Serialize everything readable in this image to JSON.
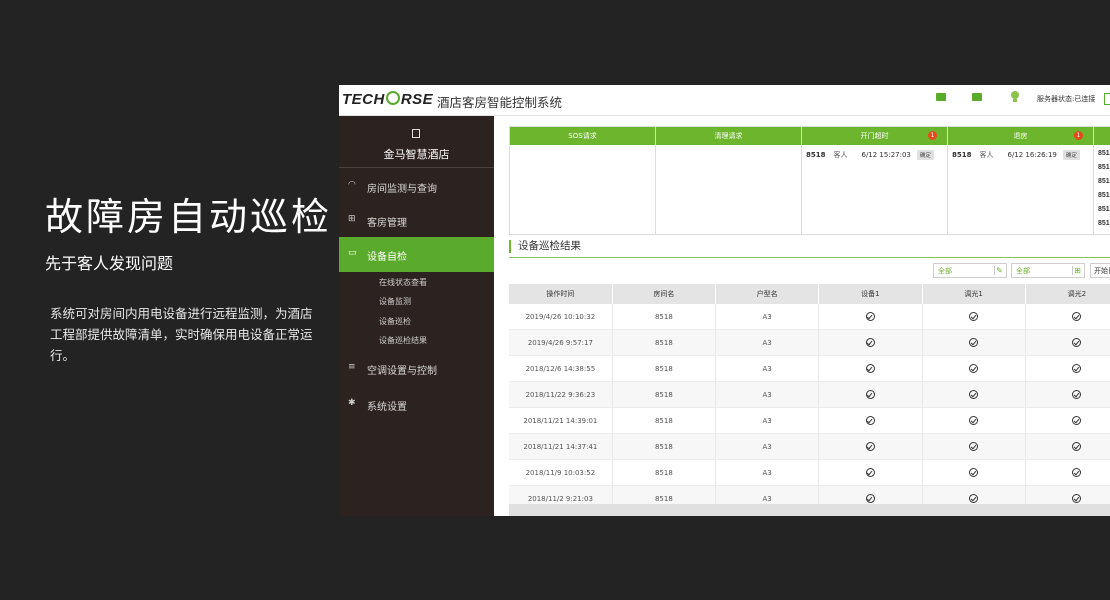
{
  "promo": {
    "headline": "故障房自动巡检",
    "subline": "先于客人发现问题",
    "description": "系统可对房间内用电设备进行远程监测，为酒店工程部提供故障清单，实时确保用电设备正常运行。"
  },
  "app": {
    "logo": {
      "part1": "TECH",
      "part2": "RSE"
    },
    "system_name": "酒店客房智能控制系统",
    "service_status": "服务器状态:已连接",
    "hotel_name": "金马智慧酒店",
    "nav": [
      {
        "label": "房间监测与查询",
        "icon": "gauge-icon"
      },
      {
        "label": "客房管理",
        "icon": "grid-icon"
      },
      {
        "label": "设备自检",
        "icon": "monitor-icon",
        "active": true
      },
      {
        "label": "空调设置与控制",
        "icon": "aircon-icon"
      },
      {
        "label": "系统设置",
        "icon": "gear-icon"
      }
    ],
    "subnav": [
      "在线状态查看",
      "设备监测",
      "设备巡检",
      "设备巡检结果"
    ],
    "requests": [
      {
        "title": "SOS请求",
        "rows": []
      },
      {
        "title": "清理请求",
        "rows": []
      },
      {
        "title": "开门超时",
        "badge": "1",
        "rows": [
          {
            "room": "8518",
            "who": "客人",
            "time": "6/12 15:27:03",
            "action": "确定"
          }
        ]
      },
      {
        "title": "退房",
        "badge": "1",
        "rows": [
          {
            "room": "8518",
            "who": "客人",
            "time": "6/12 16:26:19",
            "action": "确定"
          }
        ]
      },
      {
        "title": "",
        "rows": [
          {
            "room": "851"
          },
          {
            "room": "851"
          },
          {
            "room": "851"
          },
          {
            "room": "851"
          },
          {
            "room": "851"
          },
          {
            "room": "851"
          }
        ]
      }
    ],
    "section_title": "设备巡检结果",
    "filters": {
      "f1": "全部",
      "f2": "全部",
      "start": "开始日"
    },
    "table": {
      "headers": [
        "操作时间",
        "房间名",
        "户型名",
        "设备1",
        "调光1",
        "调光2"
      ],
      "rows": [
        [
          "2019/4/26 10:10:32",
          "8518",
          "A3"
        ],
        [
          "2019/4/26 9:57:17",
          "8518",
          "A3"
        ],
        [
          "2018/12/6 14:38:55",
          "8518",
          "A3"
        ],
        [
          "2018/11/22 9:36:23",
          "8518",
          "A3"
        ],
        [
          "2018/11/21 14:39:01",
          "8518",
          "A3"
        ],
        [
          "2018/11/21 14:37:41",
          "8518",
          "A3"
        ],
        [
          "2018/11/9 10:03:52",
          "8518",
          "A3"
        ],
        [
          "2018/11/2 9:21:03",
          "8518",
          "A3"
        ]
      ]
    },
    "colors": {
      "accent": "#6eb52e",
      "sidebar": "#2c2320",
      "page_bg": "#232323"
    }
  }
}
